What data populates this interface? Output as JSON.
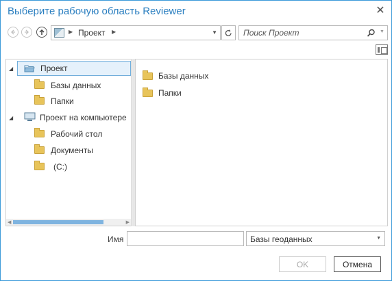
{
  "window": {
    "title": "Выберите рабочую область Reviewer"
  },
  "nav": {
    "path_label": "Проект",
    "search_placeholder": "Поиск Проект"
  },
  "tree": {
    "items": [
      {
        "label": "Проект",
        "icon": "project-folder-icon",
        "selected": true
      },
      {
        "label": "Базы данных",
        "icon": "databases-folder-icon"
      },
      {
        "label": "Папки",
        "icon": "folders-folder-icon"
      },
      {
        "label": "Проект на компьютере",
        "icon": "computer-icon"
      },
      {
        "label": "Рабочий стол",
        "icon": "folder-icon"
      },
      {
        "label": "Документы",
        "icon": "folder-icon"
      },
      {
        "label": "(C:)",
        "icon": "folder-icon"
      }
    ]
  },
  "content": {
    "items": [
      {
        "label": "Базы данных",
        "icon": "databases-folder-icon"
      },
      {
        "label": "Папки",
        "icon": "folders-folder-icon"
      }
    ]
  },
  "bottom": {
    "name_label": "Имя",
    "name_value": "",
    "type_value": "Базы геоданных",
    "ok_label": "OK",
    "cancel_label": "Отмена"
  },
  "colors": {
    "accent": "#2b7fc0",
    "border": "#3a9ad9",
    "selection": "#e5f1fb",
    "folder": "#e8c45a"
  }
}
